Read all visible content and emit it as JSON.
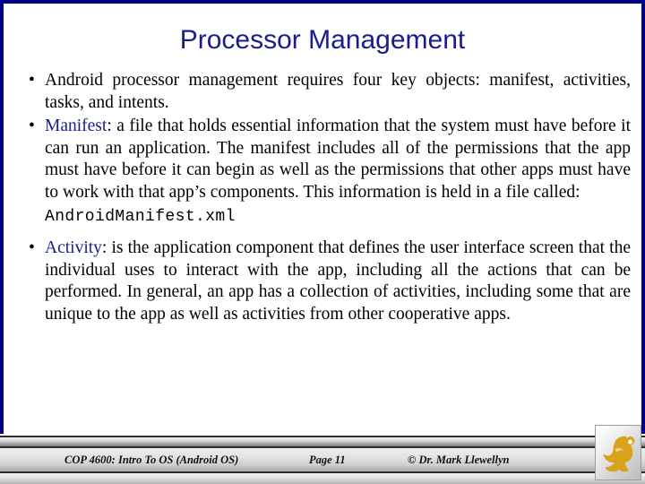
{
  "slide": {
    "title": "Processor Management",
    "title_color": "#1b1b8f",
    "keyword_color": "#1b1b8f",
    "border_color": "#000080",
    "background_color": "#ffffff"
  },
  "bullets": [
    {
      "marker": "•",
      "parts": [
        {
          "style": "normal",
          "text": "Android processor management requires four key objects: manifest, activities, tasks, and intents."
        }
      ]
    },
    {
      "marker": "•",
      "parts": [
        {
          "style": "keyword",
          "text": "Manifest"
        },
        {
          "style": "normal",
          "text": ": a file that holds essential information that the system must have before it can run an application.  The manifest includes all of the permissions that the app must have before it can begin as well as the permissions that other apps must have to work with that app’s components.  This information is held in a file called:"
        },
        {
          "style": "mono",
          "text": "AndroidManifest.xml"
        }
      ]
    },
    {
      "marker": "•",
      "parts": [
        {
          "style": "keyword",
          "text": "Activity"
        },
        {
          "style": "normal",
          "text": ": is the application component that defines the user interface screen that the individual uses to interact with the app, including all the actions that can be performed.  In general, an app has a collection of activities, including some that are unique to the app as well as activities from other cooperative apps."
        }
      ]
    }
  ],
  "footer": {
    "course": "COP 4600: Intro To OS  (Android OS)",
    "page": "Page 11",
    "copyright": "© Dr. Mark Llewellyn",
    "logo_name": "ucf-pegasus-logo",
    "logo_color": "#d9a21b"
  }
}
